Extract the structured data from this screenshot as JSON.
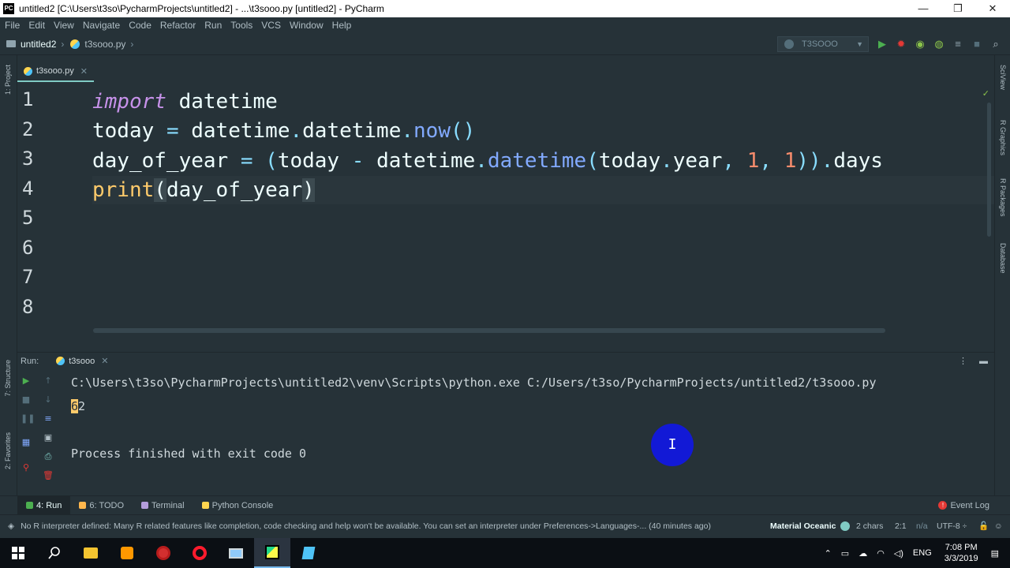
{
  "window": {
    "title": "untitled2 [C:\\Users\\t3so\\PycharmProjects\\untitled2] - ...\\t3sooo.py [untitled2] - PyCharm",
    "app_badge": "PC",
    "minimize": "—",
    "maximize": "❐",
    "close": "✕"
  },
  "menu": [
    "File",
    "Edit",
    "View",
    "Navigate",
    "Code",
    "Refactor",
    "Run",
    "Tools",
    "VCS",
    "Window",
    "Help"
  ],
  "nav": {
    "project": "untitled2",
    "file": "t3sooo.py",
    "run_config": "T3SOOO"
  },
  "left_stripe": {
    "project": "1: Project",
    "structure": "7: Structure",
    "favorites": "2: Favorites"
  },
  "right_stripe": {
    "sciview": "SciView",
    "r_graphics": "R Graphics",
    "r_packages": "R Packages",
    "database": "Database"
  },
  "editor": {
    "tab_label": "t3sooo.py",
    "tab_close": "✕",
    "line_numbers": [
      "1",
      "2",
      "3",
      "4",
      "5",
      "6",
      "7",
      "8"
    ],
    "check": "✓"
  },
  "run_panel": {
    "label": "Run:",
    "tab": "t3sooo",
    "tab_close": "✕",
    "command": "C:\\Users\\t3so\\PycharmProjects\\untitled2\\venv\\Scripts\\python.exe C:/Users/t3so/PycharmProjects/untitled2/t3sooo.py",
    "output_selected": "6",
    "output_rest": "2",
    "finish": "Process finished with exit code 0",
    "cursor": "I"
  },
  "bottom_tools": {
    "run": "4: Run",
    "todo": "6: TODO",
    "terminal": "Terminal",
    "python_console": "Python Console",
    "event_log": "Event Log",
    "event_badge": "!"
  },
  "status": {
    "message": "No R interpreter defined: Many R related features like completion, code checking and help won't be available. You can set an interpreter under Preferences->Languages-... (40 minutes ago)",
    "theme": "Material Oceanic",
    "chars": "2 chars",
    "position": "2:1",
    "na": "n/a",
    "encoding": "UTF-8 ÷"
  },
  "taskbar": {
    "language": "ENG",
    "time": "7:08 PM",
    "date": "3/3/2019"
  },
  "colors": {
    "background": "#263238",
    "keyword": "#c792ea",
    "function": "#82aaff",
    "number": "#f78c6c",
    "builtin": "#ffcb6b",
    "accent": "#80cbc4"
  }
}
